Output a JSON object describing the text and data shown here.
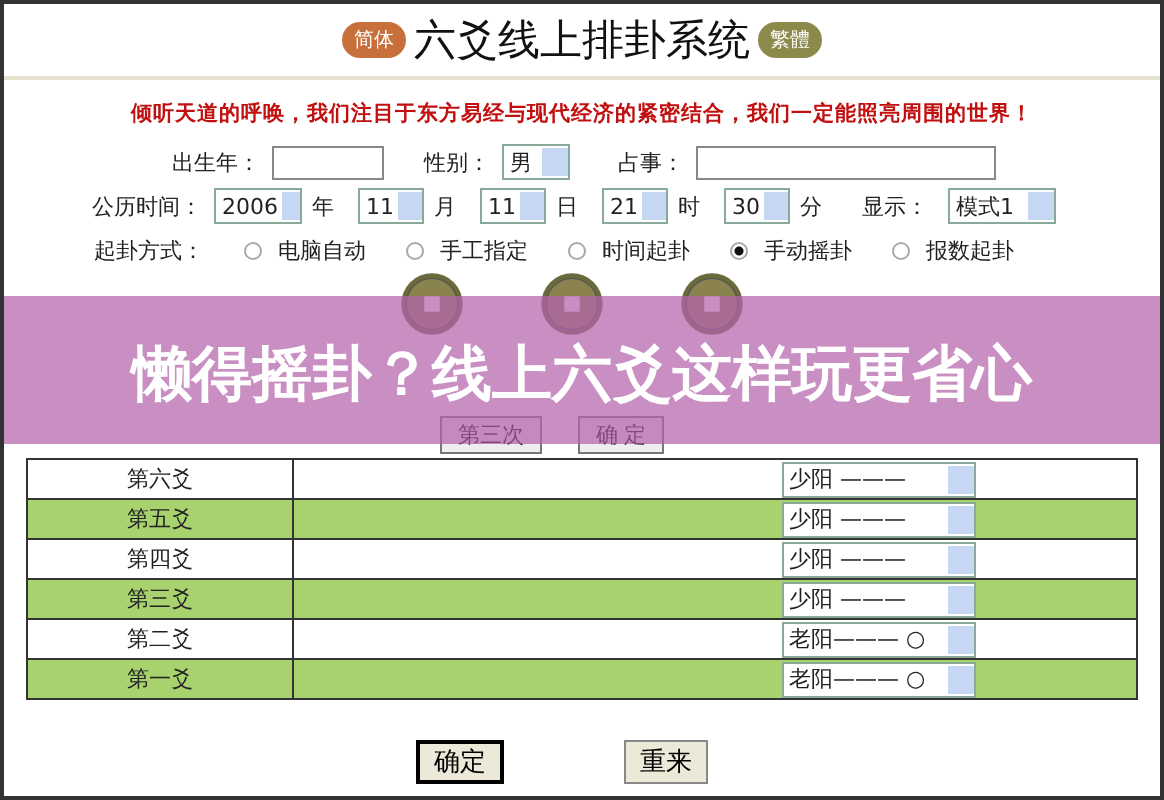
{
  "header": {
    "title": "六爻线上排卦系统",
    "badges": [
      {
        "label": "简体",
        "kind": "simplified"
      },
      {
        "label": "繁體",
        "kind": "traditional"
      }
    ]
  },
  "slogan": "倾听天道的呼唤，我们注目于东方易经与现代经济的紧密结合，我们一定能照亮周围的世界！",
  "form": {
    "birth_year": {
      "label": "出生年："
    },
    "gender": {
      "label": "性别：",
      "value": "男"
    },
    "matter": {
      "label": "占事："
    },
    "date": {
      "label": "公历时间：",
      "parts": [
        {
          "value": "2006",
          "unit": "年"
        },
        {
          "value": "11",
          "unit": "月"
        },
        {
          "value": "11",
          "unit": "日"
        },
        {
          "value": "21",
          "unit": "时"
        },
        {
          "value": "30",
          "unit": "分"
        }
      ]
    },
    "display": {
      "label": "显示：",
      "value": "模式1"
    },
    "method": {
      "label": "起卦方式：",
      "options": [
        {
          "label": "电脑自动",
          "selected": false
        },
        {
          "label": "手工指定",
          "selected": false
        },
        {
          "label": "时间起卦",
          "selected": false
        },
        {
          "label": "手动摇卦",
          "selected": true
        },
        {
          "label": "报数起卦",
          "selected": false
        }
      ]
    }
  },
  "shake_buttons": [
    "第三次",
    "确 定"
  ],
  "lines": [
    {
      "label": "第六爻",
      "value": "少阳 ———"
    },
    {
      "label": "第五爻",
      "value": "少阳 ———"
    },
    {
      "label": "第四爻",
      "value": "少阳 ———"
    },
    {
      "label": "第三爻",
      "value": "少阳 ———"
    },
    {
      "label": "第二爻",
      "value": "老阳——— ○"
    },
    {
      "label": "第一爻",
      "value": "老阳——— ○"
    }
  ],
  "bottom_buttons": [
    {
      "label": "确定",
      "focused": true
    },
    {
      "label": "重来",
      "focused": false
    }
  ],
  "banner": {
    "text": "懒得摇卦？线上六爻这样玩更省心"
  }
}
